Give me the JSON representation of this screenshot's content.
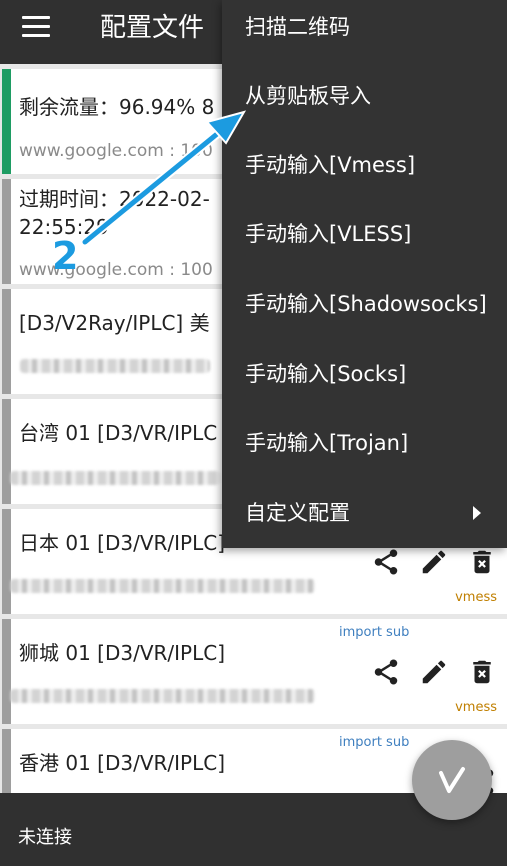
{
  "appbar": {
    "title": "配置文件"
  },
  "servers": [
    {
      "name": "剩余流量：96.94% 8",
      "address": "www.google.com : 100",
      "active": true
    },
    {
      "name_line1": "过期时间：2022-02-",
      "name_line2": "22:55:29",
      "address": "www.google.com : 100"
    },
    {
      "name": "[D3/V2Ray/IPLC] 美"
    },
    {
      "name": "台湾 01 [D3/VR/IPLC"
    },
    {
      "name": "日本 01 [D3/VR/IPLC]",
      "type": "vmess"
    },
    {
      "name": "狮城 01 [D3/VR/IPLC]",
      "sub": "import sub",
      "type": "vmess"
    },
    {
      "name": "香港 01 [D3/VR/IPLC]",
      "sub": "import sub"
    }
  ],
  "menu": {
    "items": [
      "扫描二维码",
      "从剪贴板导入",
      "手动输入[Vmess]",
      "手动输入[VLESS]",
      "手动输入[Shadowsocks]",
      "手动输入[Socks]",
      "手动输入[Trojan]",
      "自定义配置"
    ]
  },
  "annotation": {
    "step": "2"
  },
  "status": {
    "text": "未连接"
  },
  "icons": {
    "share": "share-icon",
    "edit": "pencil-icon",
    "delete": "trash-icon",
    "fab": "v-logo-icon"
  },
  "colors": {
    "active_bar": "#1e9c63",
    "arrow": "#1c9be0",
    "tag": "#c07f00"
  }
}
